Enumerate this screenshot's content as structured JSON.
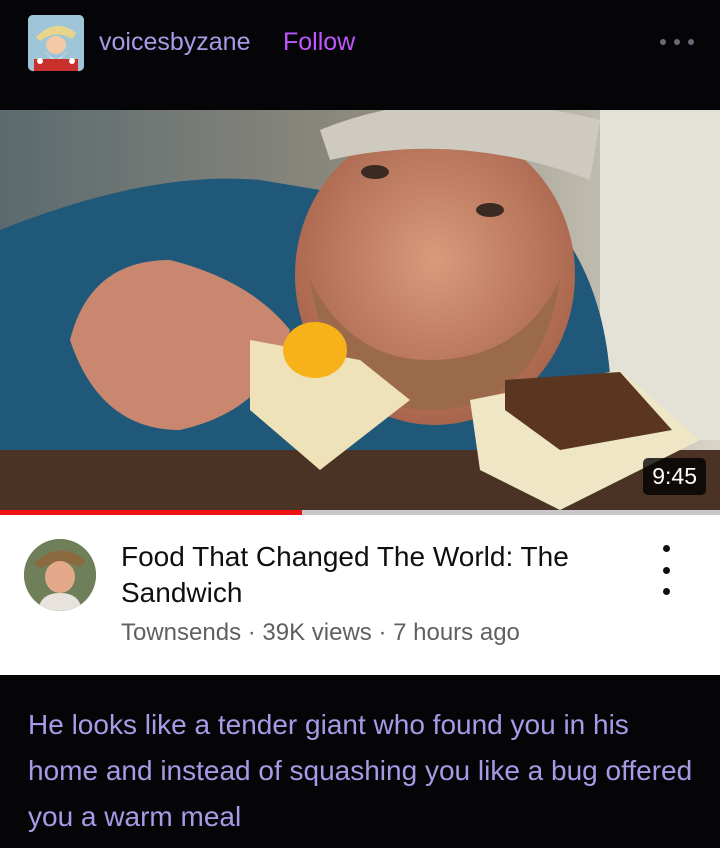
{
  "post": {
    "username": "voicesbyzane",
    "follow_label": "Follow",
    "more_icon": "more-horizontal-icon"
  },
  "video": {
    "duration": "9:45",
    "progress_fraction": 0.42,
    "title": "Food That Changed The World: The Sandwich",
    "channel": "Townsends",
    "views": "39K views",
    "age": "7 hours ago",
    "separator": " · ",
    "menu_icon": "more-vertical-icon"
  },
  "caption": {
    "text": "He looks like a tender giant who found you in his home and instead of squashing you like a bug offered you a warm meal"
  },
  "colors": {
    "username": "#a79ae6",
    "follow": "#c056ff",
    "caption": "#a79ae6",
    "progress": "#ee1111"
  }
}
